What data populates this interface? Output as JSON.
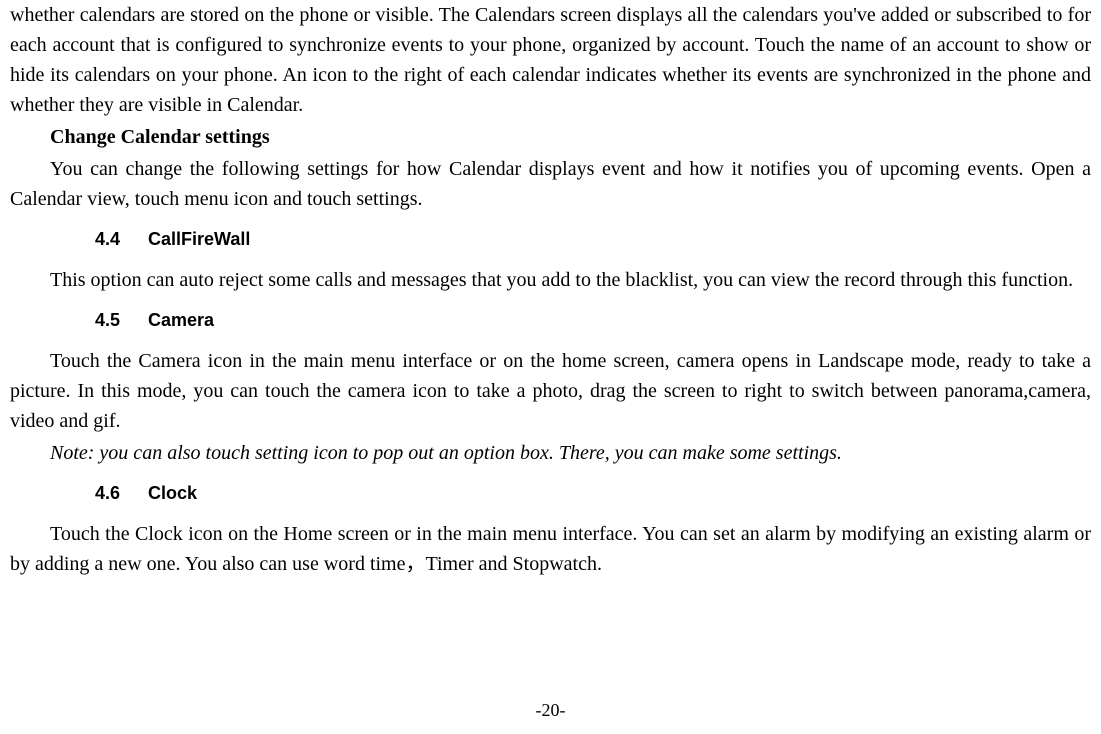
{
  "topParagraph": "whether calendars are stored on the phone or visible. The Calendars screen displays all the calendars you've added or subscribed to for each account that is configured to synchronize events to your phone, organized by account. Touch the name of an account to show or hide its calendars on your phone. An icon to the right of each calendar indicates whether its events are synchronized in the phone and whether they are visible in Calendar.",
  "changeSettingsTitle": "Change Calendar settings",
  "changeSettingsText": "You can change the following settings for how Calendar displays event and how it notifies you of upcoming events. Open a Calendar view, touch menu icon and touch settings.",
  "section44": {
    "num": "4.4",
    "title": "CallFireWall",
    "body": "This option can auto reject some calls and messages that you add to the blacklist, you can view the record through this function."
  },
  "section45": {
    "num": "4.5",
    "title": "Camera",
    "body": "Touch the Camera icon in the main menu interface or on the home screen, camera opens in Landscape mode, ready to take a picture. In this mode, you can touch the camera icon to take a photo, drag the screen to right to switch between panorama,camera, video and gif.",
    "note": "Note: you can also touch setting icon to pop out an option box. There, you can make some settings."
  },
  "section46": {
    "num": "4.6",
    "title": "Clock",
    "body": "Touch the Clock icon on the Home screen or in the main menu interface. You can set an alarm by modifying an existing alarm or by adding a new one. You also can use word time，Timer and Stopwatch."
  },
  "pageNumber": "-20-"
}
